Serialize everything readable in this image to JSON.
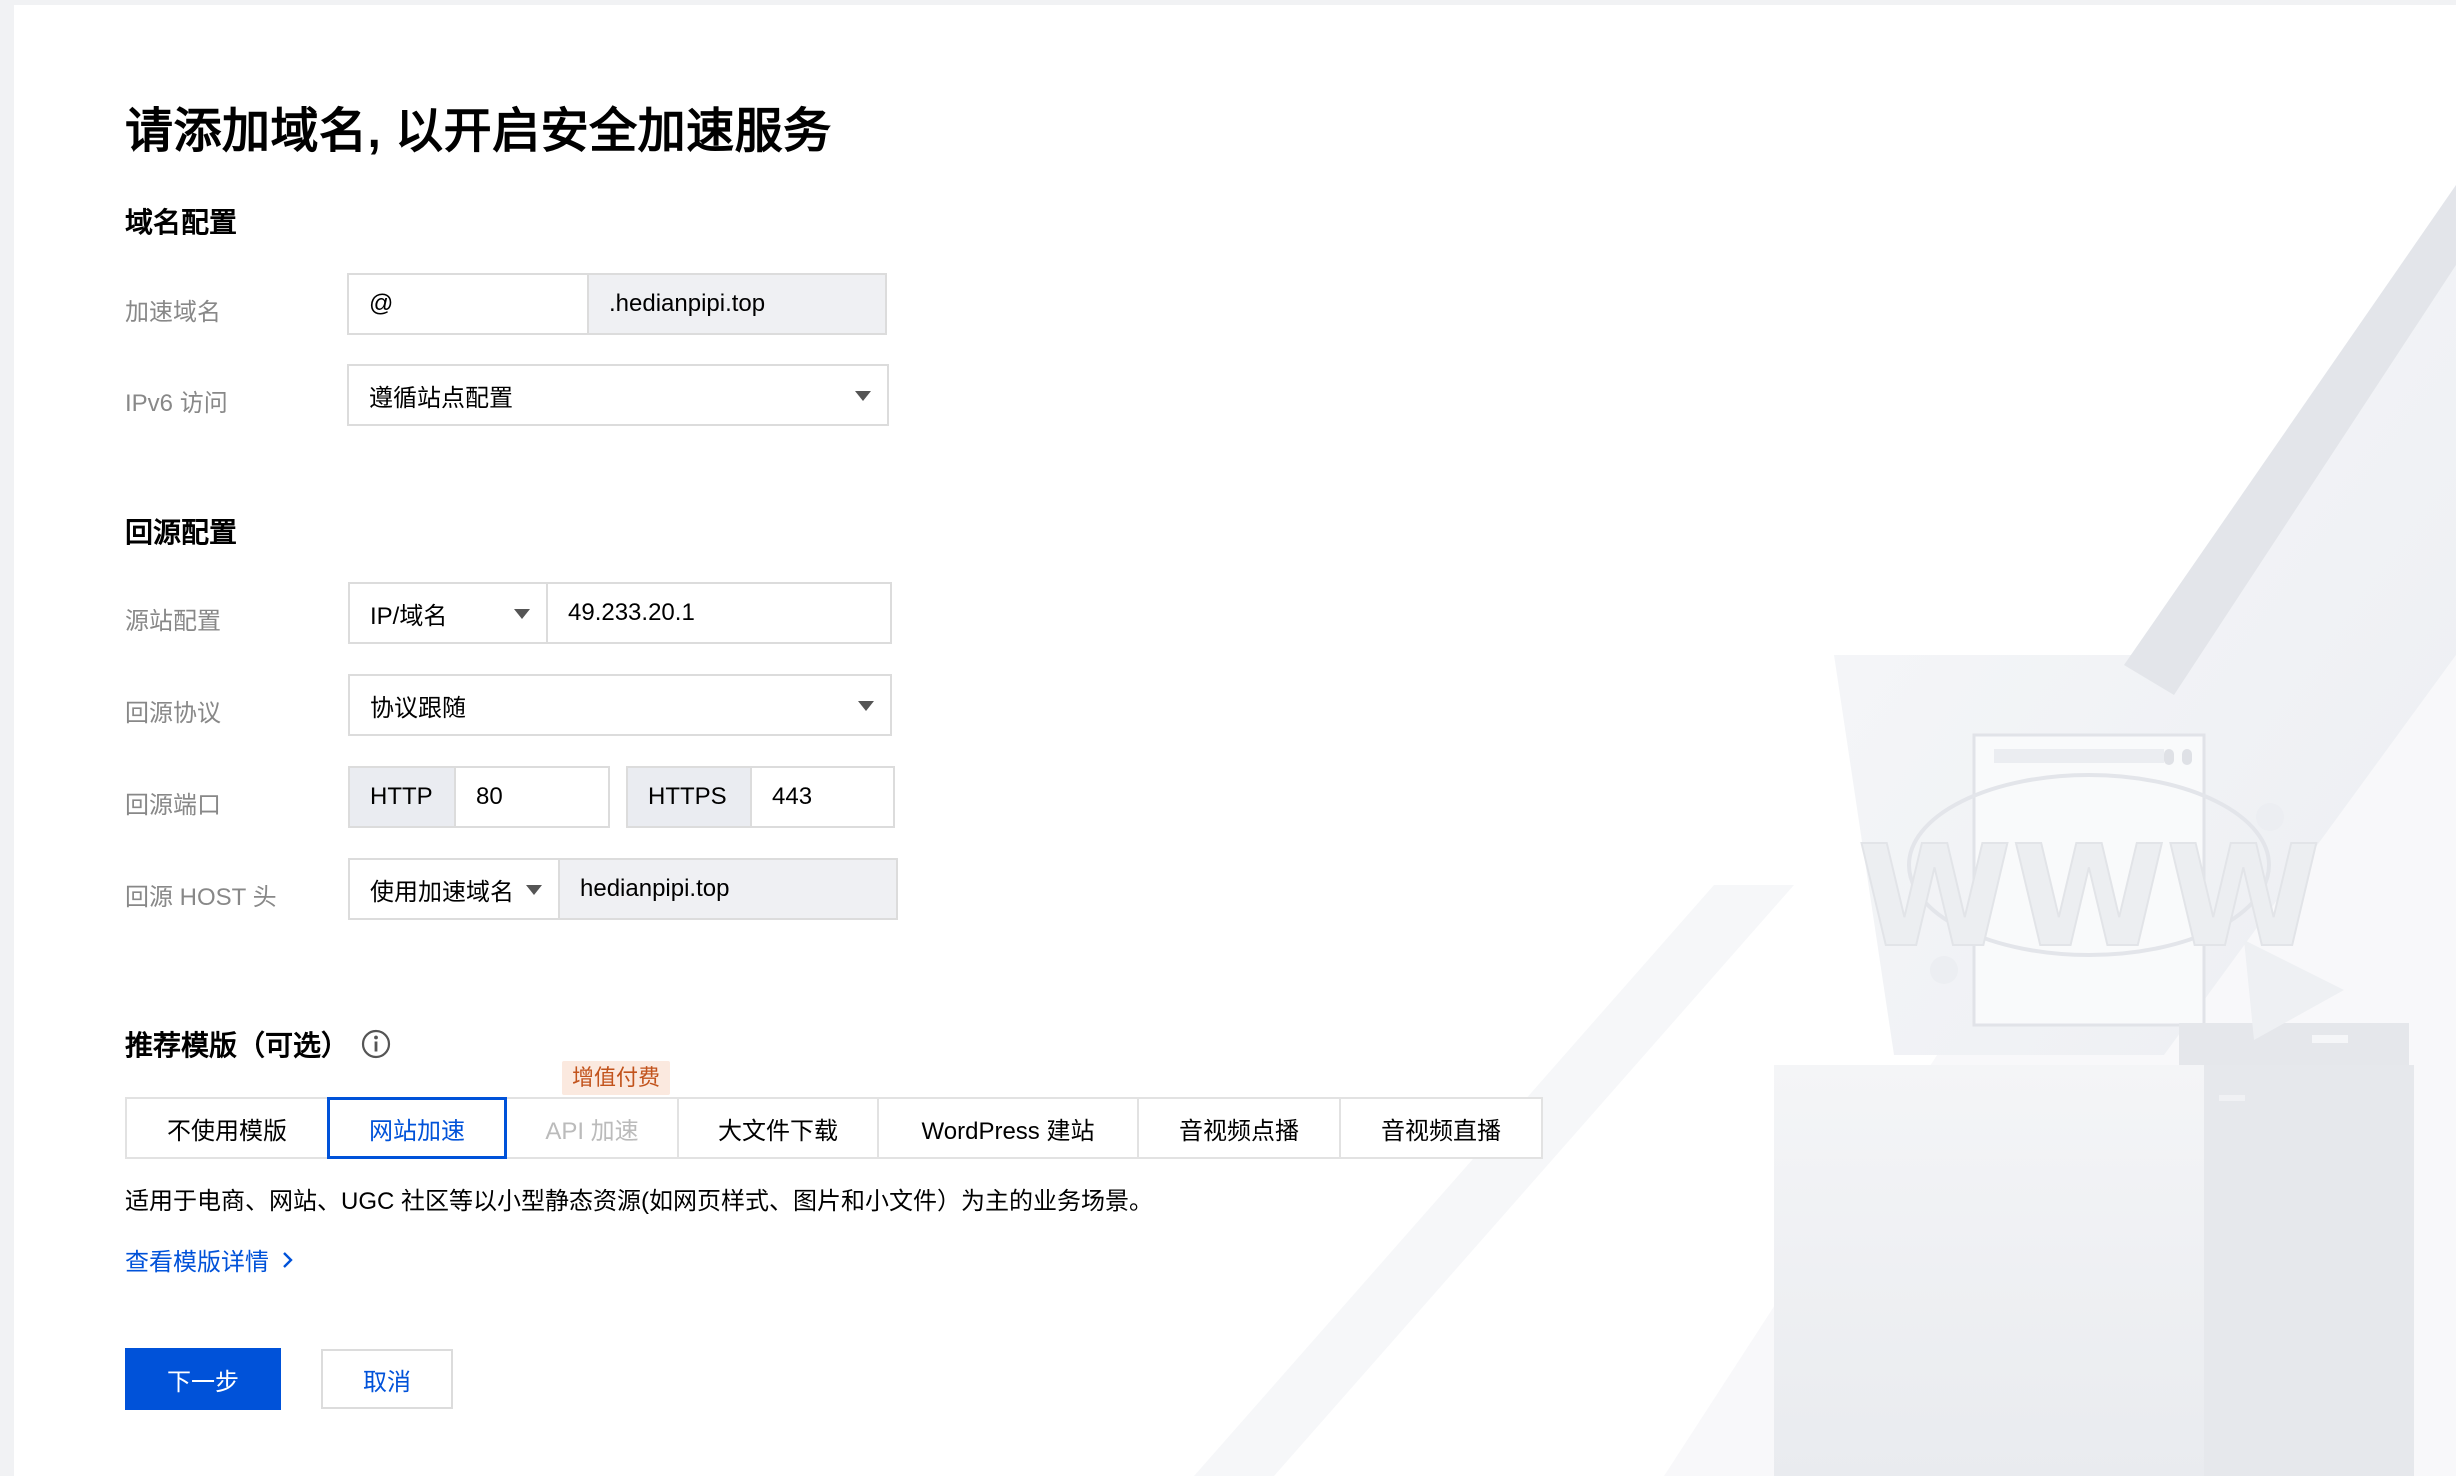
{
  "page": {
    "title": "请添加域名, 以开启安全加速服务"
  },
  "domain_config": {
    "section_title": "域名配置",
    "accel_domain": {
      "label": "加速域名",
      "prefix_value": "@",
      "suffix": ".hedianpipi.top"
    },
    "ipv6": {
      "label": "IPv6 访问",
      "value": "遵循站点配置"
    }
  },
  "origin_config": {
    "section_title": "回源配置",
    "origin_site": {
      "label": "源站配置",
      "type_value": "IP/域名",
      "address_value": "49.233.20.1"
    },
    "origin_protocol": {
      "label": "回源协议",
      "value": "协议跟随"
    },
    "origin_port": {
      "label": "回源端口",
      "http_label": "HTTP",
      "http_value": "80",
      "https_label": "HTTPS",
      "https_value": "443"
    },
    "origin_host": {
      "label": "回源 HOST 头",
      "mode_value": "使用加速域名",
      "host_value": "hedianpipi.top"
    }
  },
  "templates": {
    "section_title": "推荐模版（可选）",
    "badge": "增值付费",
    "tabs": [
      {
        "label": "不使用模版"
      },
      {
        "label": "网站加速"
      },
      {
        "label": "API 加速"
      },
      {
        "label": "大文件下载"
      },
      {
        "label": "WordPress 建站"
      },
      {
        "label": "音视频点播"
      },
      {
        "label": "音视频直播"
      }
    ],
    "active_tab": "网站加速",
    "description": "适用于电商、网站、UGC 社区等以小型静态资源(如网页样式、图片和小文件）为主的业务场景。",
    "details_link": "查看模版详情"
  },
  "actions": {
    "next_label": "下一步",
    "cancel_label": "取消"
  },
  "illustration": {
    "text": "WWW"
  },
  "colors": {
    "primary": "#0052d9",
    "badge_bg": "#fbe9df",
    "badge_text": "#c2531c",
    "label": "#888888",
    "border": "#dcdcdc"
  },
  "icons": {
    "info": "info-circle-icon",
    "dropdown": "caret-down-icon",
    "link_arrow": "chevron-right-icon"
  }
}
